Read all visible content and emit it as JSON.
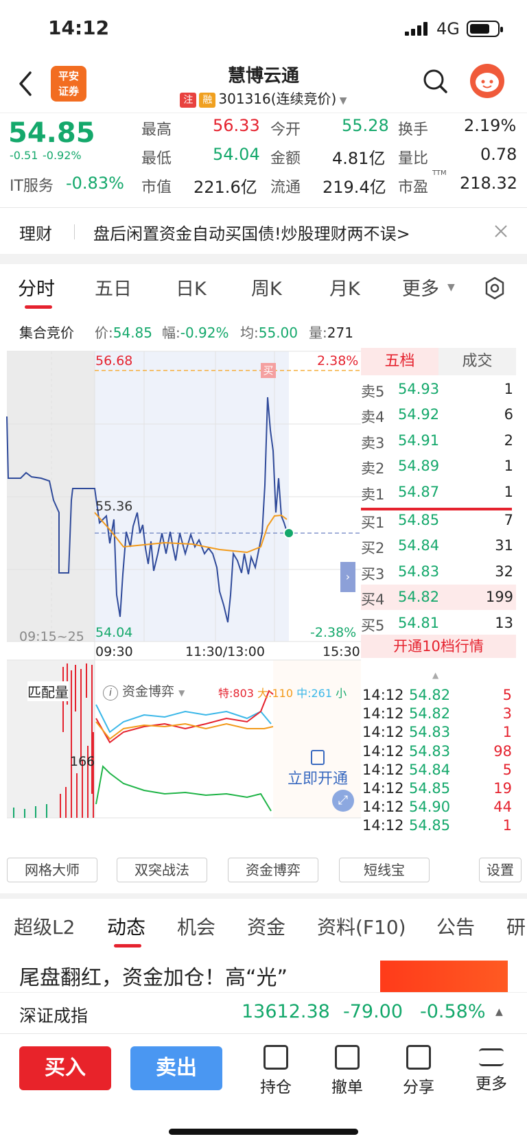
{
  "status_bar": {
    "time": "14:12",
    "network": "4G"
  },
  "header": {
    "logo_text": "平安证券",
    "stock_name": "慧博云通",
    "tag_zhu": "注",
    "tag_rong": "融",
    "stock_code": "301316(连续竞价)"
  },
  "quote": {
    "price": "54.85",
    "change": "-0.51",
    "change_pct": "-0.92%",
    "sector_name": "IT服务",
    "sector_pct": "-0.83%",
    "high_label": "最高",
    "high": "56.33",
    "low_label": "最低",
    "low": "54.04",
    "mcap_label": "市值",
    "mcap": "221.6亿",
    "open_label": "今开",
    "open": "55.28",
    "amount_label": "金额",
    "amount": "4.81亿",
    "float_label": "流通",
    "float": "219.4亿",
    "turnover_label": "换手",
    "turnover": "2.19%",
    "vol_ratio_label": "量比",
    "vol_ratio": "0.78",
    "pe_label": "市盈",
    "pe_sup": "TTM",
    "pe": "218.32"
  },
  "ad": {
    "label": "理财",
    "text": "盘后闲置资金自动买国债!炒股理财两不误>"
  },
  "chart_tabs": [
    "分时",
    "五日",
    "日K",
    "周K",
    "月K",
    "更多"
  ],
  "auction": {
    "label": "集合竞价",
    "price_label": "价:",
    "price": "54.85",
    "range_label": "幅:",
    "range": "-0.92%",
    "avg_label": "均:",
    "avg": "55.00",
    "vol_label": "量:",
    "vol": "271"
  },
  "chart": {
    "top_price": "56.68",
    "mid_price": "55.36",
    "bottom_price": "54.04",
    "top_pct": "2.38%",
    "bottom_pct": "-2.38%",
    "time_pre": "09:15~25",
    "time_open": "09:30",
    "time_mid": "11:30/13:00",
    "time_close": "15:30",
    "buy_marker": "买",
    "match_label": "匹配量",
    "match_value": "166",
    "fund_label": "资金博弈",
    "te_label": "特:",
    "te": "803",
    "da_label": "大:",
    "da": "110",
    "zhong_label": "中:",
    "zhong": "261",
    "xiao_label": "小",
    "unlock_label": "立即开通"
  },
  "orderbook": {
    "tab_five": "五档",
    "tab_deals": "成交",
    "asks": [
      {
        "label": "卖5",
        "price": "54.93",
        "vol": "1"
      },
      {
        "label": "卖4",
        "price": "54.92",
        "vol": "6"
      },
      {
        "label": "卖3",
        "price": "54.91",
        "vol": "2"
      },
      {
        "label": "卖2",
        "price": "54.89",
        "vol": "1"
      },
      {
        "label": "卖1",
        "price": "54.87",
        "vol": "1"
      }
    ],
    "bids": [
      {
        "label": "买1",
        "price": "54.85",
        "vol": "7"
      },
      {
        "label": "买2",
        "price": "54.84",
        "vol": "31"
      },
      {
        "label": "买3",
        "price": "54.83",
        "vol": "32"
      },
      {
        "label": "买4",
        "price": "54.82",
        "vol": "199"
      },
      {
        "label": "买5",
        "price": "54.81",
        "vol": "13"
      }
    ],
    "upgrade": "开通10档行情"
  },
  "ticks": [
    {
      "time": "14:12",
      "price": "54.82",
      "vol": "5"
    },
    {
      "time": "14:12",
      "price": "54.82",
      "vol": "3"
    },
    {
      "time": "14:12",
      "price": "54.83",
      "vol": "1"
    },
    {
      "time": "14:12",
      "price": "54.83",
      "vol": "98"
    },
    {
      "time": "14:12",
      "price": "54.84",
      "vol": "5"
    },
    {
      "time": "14:12",
      "price": "54.85",
      "vol": "19"
    },
    {
      "time": "14:12",
      "price": "54.90",
      "vol": "44"
    },
    {
      "time": "14:12",
      "price": "54.85",
      "vol": "1"
    }
  ],
  "tools": [
    "网格大师",
    "双突战法",
    "资金博弈",
    "短线宝",
    "设置"
  ],
  "info_tabs": [
    "超级L2",
    "动态",
    "机会",
    "资金",
    "资料(F10)",
    "公告",
    "研"
  ],
  "news": {
    "headline": "尾盘翻红，资金加仓！高“光”"
  },
  "index_bar": {
    "name": "深证成指",
    "value": "13612.38",
    "change": "-79.00",
    "pct": "-0.58%"
  },
  "actions": {
    "buy": "买入",
    "sell": "卖出",
    "hold": "持仓",
    "cancel": "撤单",
    "share": "分享",
    "more": "更多"
  }
}
